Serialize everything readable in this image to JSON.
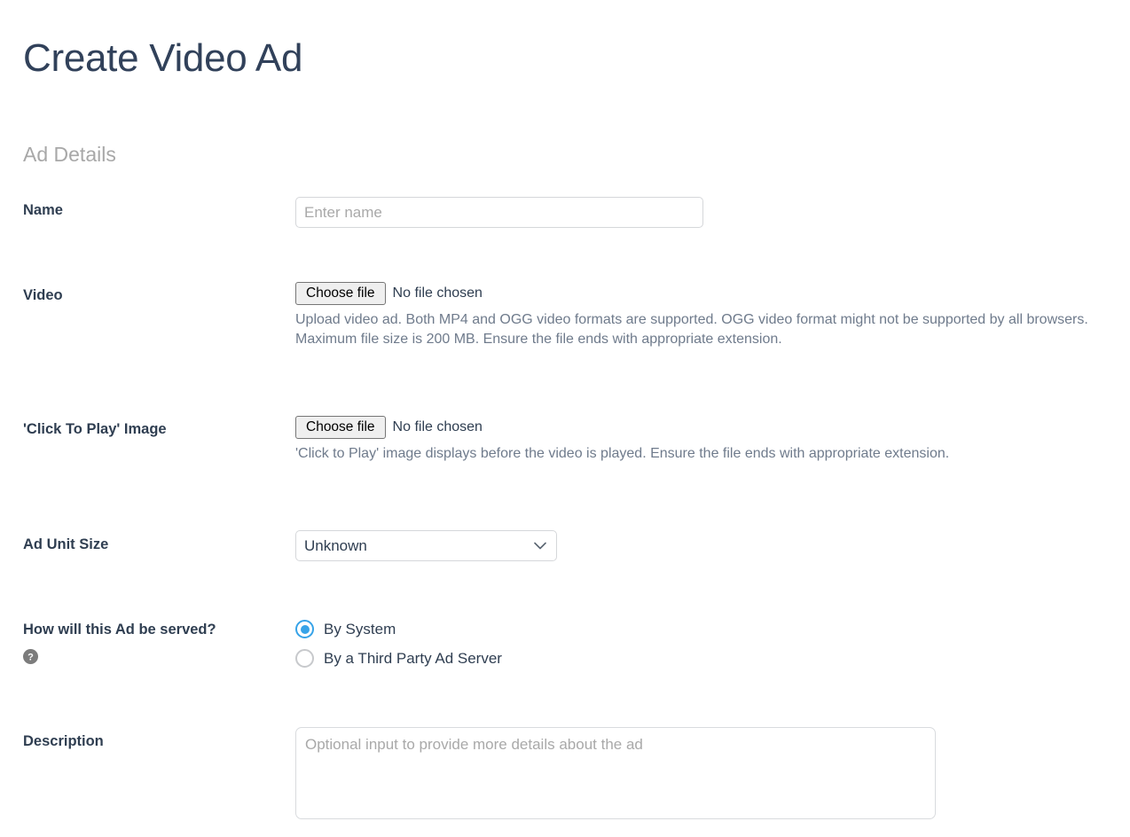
{
  "page": {
    "title": "Create Video Ad"
  },
  "section": {
    "title": "Ad Details"
  },
  "fields": {
    "name": {
      "label": "Name",
      "placeholder": "Enter name",
      "value": ""
    },
    "video": {
      "label": "Video",
      "button_label": "Choose file",
      "file_status": "No file chosen",
      "help": "Upload video ad. Both MP4 and OGG video formats are supported. OGG video format might not be supported by all browsers. Maximum file size is 200 MB. Ensure the file ends with appropriate extension."
    },
    "click_to_play_image": {
      "label": "'Click To Play' Image",
      "button_label": "Choose file",
      "file_status": "No file chosen",
      "help": "'Click to Play' image displays before the video is played. Ensure the file ends with appropriate extension."
    },
    "ad_unit_size": {
      "label": "Ad Unit Size",
      "selected": "Unknown",
      "chevron_icon": "chevron-down-icon"
    },
    "served_by": {
      "label": "How will this Ad be served?",
      "help_icon": "question-mark-circle-icon",
      "options": [
        {
          "label": "By System",
          "checked": true
        },
        {
          "label": "By a Third Party Ad Server",
          "checked": false
        }
      ]
    },
    "description": {
      "label": "Description",
      "placeholder": "Optional input to provide more details about the ad",
      "value": ""
    }
  },
  "colors": {
    "title": "#31415a",
    "label": "#2f3e51",
    "section_heading": "#a8a8a8",
    "help_text": "#6f7b8c",
    "accent_radio": "#37a3e8",
    "input_border": "#d5d7da",
    "file_button_bg": "#efefef"
  }
}
